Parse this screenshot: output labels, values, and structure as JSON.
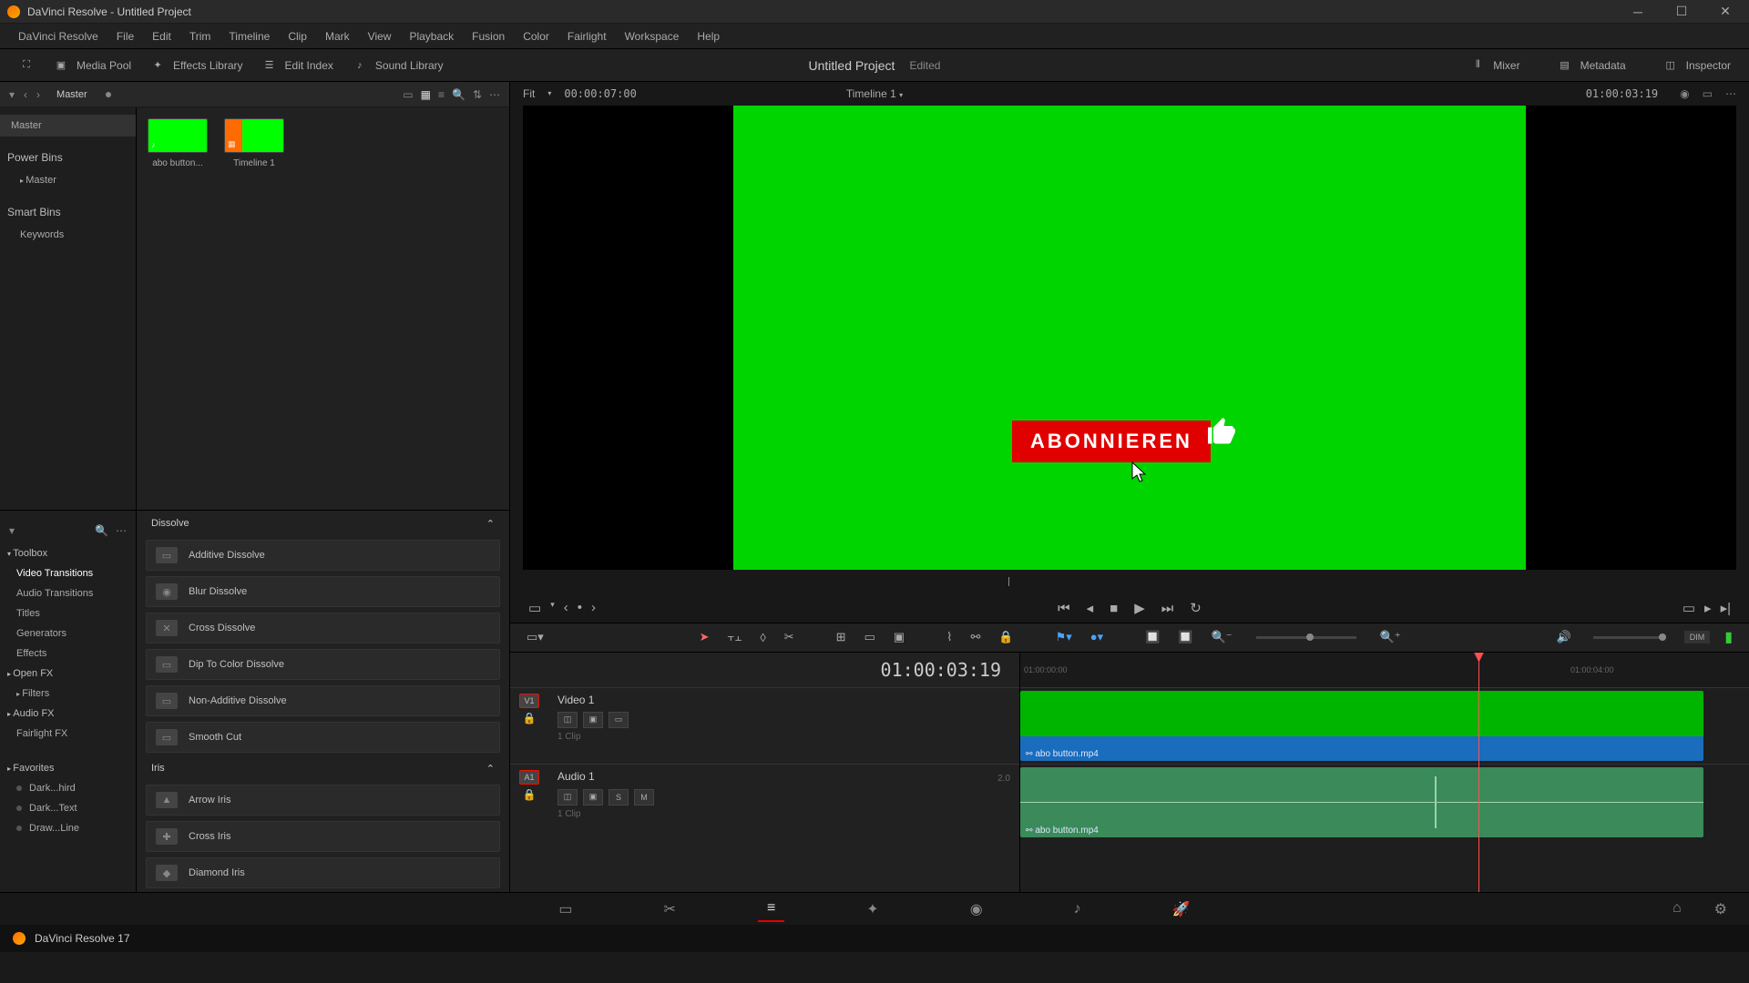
{
  "window": {
    "title": "DaVinci Resolve - Untitled Project"
  },
  "menu": [
    "DaVinci Resolve",
    "File",
    "Edit",
    "Trim",
    "Timeline",
    "Clip",
    "Mark",
    "View",
    "Playback",
    "Fusion",
    "Color",
    "Fairlight",
    "Workspace",
    "Help"
  ],
  "panel_buttons": {
    "media_pool": "Media Pool",
    "effects_library": "Effects Library",
    "edit_index": "Edit Index",
    "sound_library": "Sound Library",
    "mixer": "Mixer",
    "metadata": "Metadata",
    "inspector": "Inspector"
  },
  "project": {
    "name": "Untitled Project",
    "state": "Edited"
  },
  "media_pool": {
    "breadcrumb": "Master",
    "bins": {
      "master": "Master",
      "power_bins": "Power Bins",
      "smart_bins": "Smart Bins",
      "keywords": "Keywords",
      "power_master": "Master"
    },
    "clips": [
      {
        "name": "abo button...",
        "kind": "video"
      },
      {
        "name": "Timeline 1",
        "kind": "timeline"
      }
    ]
  },
  "effects": {
    "categories": {
      "toolbox": "Toolbox",
      "video_transitions": "Video Transitions",
      "audio_transitions": "Audio Transitions",
      "titles": "Titles",
      "generators": "Generators",
      "effects": "Effects",
      "open_fx": "Open FX",
      "filters": "Filters",
      "audio_fx": "Audio FX",
      "fairlight_fx": "Fairlight FX",
      "favorites": "Favorites"
    },
    "favorites_list": [
      "Dark...hird",
      "Dark...Text",
      "Draw...Line"
    ],
    "groups": [
      {
        "label": "Dissolve",
        "items": [
          "Additive Dissolve",
          "Blur Dissolve",
          "Cross Dissolve",
          "Dip To Color Dissolve",
          "Non-Additive Dissolve",
          "Smooth Cut"
        ]
      },
      {
        "label": "Iris",
        "items": [
          "Arrow Iris",
          "Cross Iris",
          "Diamond Iris"
        ]
      }
    ]
  },
  "viewer": {
    "fit": "Fit",
    "source_tc": "00:00:07:00",
    "timeline_name": "Timeline 1",
    "record_tc": "01:00:03:19",
    "overlay": {
      "button_text": "ABONNIEREN"
    }
  },
  "timeline": {
    "current_tc": "01:00:03:19",
    "ruler": [
      "01:00:00:00",
      "01:00:04:00"
    ],
    "tracks": {
      "video": {
        "badge": "V1",
        "name": "Video 1",
        "clips": "1 Clip",
        "clip_name": "abo button.mp4"
      },
      "audio": {
        "badge": "A1",
        "name": "Audio 1",
        "meta": "2.0",
        "clips": "1 Clip",
        "clip_name": "abo button.mp4"
      }
    },
    "dim_label": "DIM"
  },
  "taskbar": {
    "app": "DaVinci Resolve 17"
  }
}
